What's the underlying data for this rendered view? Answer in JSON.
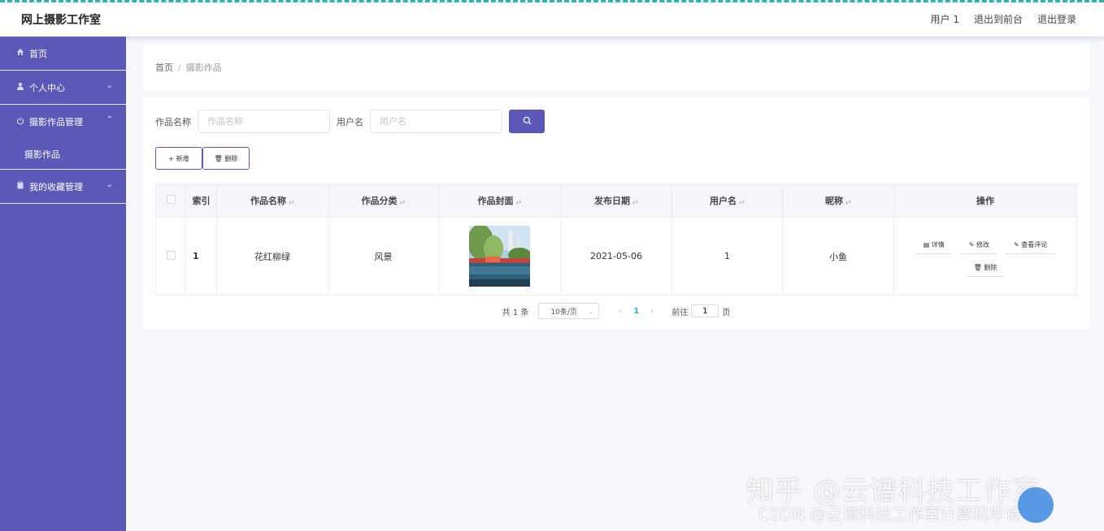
{
  "header": {
    "brand": "网上摄影工作室",
    "nav": [
      "用户 1",
      "退出到前台",
      "退出登录"
    ]
  },
  "sidebar": {
    "items": [
      {
        "label": "首页",
        "icon": "home-icon"
      },
      {
        "label": "个人中心",
        "icon": "user-icon"
      },
      {
        "label": "摄影作品管理",
        "icon": "power-icon"
      },
      {
        "label": "我的收藏管理",
        "icon": "clipboard-icon"
      }
    ],
    "sub": [
      "摄影作品"
    ]
  },
  "breadcrumb": {
    "home": "首页",
    "sep": "/",
    "current": "摄影作品"
  },
  "search": {
    "name_label": "作品名称",
    "name_placeholder": "作品名称",
    "user_label": "用户名",
    "user_placeholder": "用户名"
  },
  "toolbar": {
    "add_label": "+ 新增",
    "delete_label": "🗑 删除"
  },
  "table": {
    "headers": [
      "索引",
      "作品名称",
      "作品分类",
      "作品封面",
      "发布日期",
      "用户名",
      "昵称",
      "操作"
    ],
    "rows": [
      {
        "index": "1",
        "name": "花红柳绿",
        "category": "风景",
        "date": "2021-05-06",
        "user": "1",
        "nickname": "小鱼"
      }
    ],
    "ops": [
      "详情",
      "修改",
      "查看评论",
      "删除"
    ]
  },
  "pager": {
    "total": "共 1 条",
    "size": "10条/页",
    "current": "1",
    "goto_label": "前往",
    "goto_value": "1",
    "page_suffix": "页"
  },
  "watermark": {
    "line1": "知乎 @云谱科技工作室",
    "line2": "CSDN @云谱科技工作室计算机毕设"
  },
  "colors": {
    "accent": "#5b59b8",
    "pager_active": "#2bb3b3"
  }
}
